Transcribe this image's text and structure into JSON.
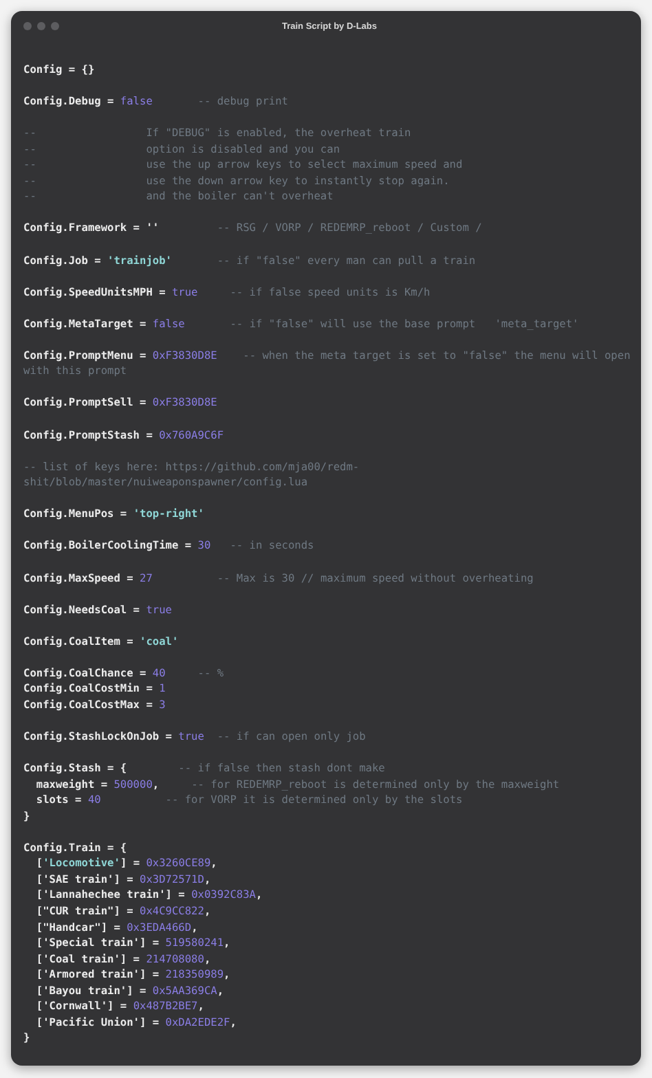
{
  "window": {
    "title": "Train Script by D-Labs"
  },
  "lines": [
    {
      "kind": "code",
      "segments": [
        {
          "kind": "code",
          "text": "Config = {}"
        }
      ]
    },
    {
      "kind": "blank"
    },
    {
      "kind": "code",
      "segments": [
        {
          "kind": "code",
          "text": "Config.Debug = "
        },
        {
          "kind": "keyword",
          "text": "false"
        },
        {
          "kind": "comment",
          "text": "       -- debug print"
        }
      ]
    },
    {
      "kind": "blank"
    },
    {
      "kind": "code",
      "segments": [
        {
          "kind": "comment",
          "text": "--                 If \"DEBUG\" is enabled, the overheat train"
        }
      ]
    },
    {
      "kind": "code",
      "segments": [
        {
          "kind": "comment",
          "text": "--                 option is disabled and you can"
        }
      ]
    },
    {
      "kind": "code",
      "segments": [
        {
          "kind": "comment",
          "text": "--                 use the up arrow keys to select maximum speed and"
        }
      ]
    },
    {
      "kind": "code",
      "segments": [
        {
          "kind": "comment",
          "text": "--                 use the down arrow key to instantly stop again."
        }
      ]
    },
    {
      "kind": "code",
      "segments": [
        {
          "kind": "comment",
          "text": "--                 and the boiler can't overheat"
        }
      ]
    },
    {
      "kind": "blank"
    },
    {
      "kind": "code",
      "segments": [
        {
          "kind": "code",
          "text": "Config.Framework = ''"
        },
        {
          "kind": "comment",
          "text": "         -- RSG / VORP / REDEMRP_reboot / Custom /"
        }
      ]
    },
    {
      "kind": "blank"
    },
    {
      "kind": "code",
      "segments": [
        {
          "kind": "code",
          "text": "Config.Job = "
        },
        {
          "kind": "string",
          "text": "'trainjob'"
        },
        {
          "kind": "comment",
          "text": "       -- if \"false\" every man can pull a train"
        }
      ]
    },
    {
      "kind": "blank"
    },
    {
      "kind": "code",
      "segments": [
        {
          "kind": "code",
          "text": "Config.SpeedUnitsMPH = "
        },
        {
          "kind": "keyword",
          "text": "true"
        },
        {
          "kind": "comment",
          "text": "     -- if false speed units is Km/h"
        }
      ]
    },
    {
      "kind": "blank"
    },
    {
      "kind": "code",
      "segments": [
        {
          "kind": "code",
          "text": "Config.MetaTarget = "
        },
        {
          "kind": "keyword",
          "text": "false"
        },
        {
          "kind": "comment",
          "text": "       -- if \"false\" will use the base prompt   'meta_target'"
        }
      ]
    },
    {
      "kind": "blank"
    },
    {
      "kind": "code",
      "segments": [
        {
          "kind": "code",
          "text": "Config.PromptMenu = "
        },
        {
          "kind": "number",
          "text": "0xF3830D8E"
        },
        {
          "kind": "comment",
          "text": "    -- when the meta target is set to \"false\" the menu will open"
        }
      ]
    },
    {
      "kind": "code",
      "segments": [
        {
          "kind": "comment",
          "text": "with this prompt"
        }
      ]
    },
    {
      "kind": "blank"
    },
    {
      "kind": "code",
      "segments": [
        {
          "kind": "code",
          "text": "Config.PromptSell = "
        },
        {
          "kind": "number",
          "text": "0xF3830D8E"
        }
      ]
    },
    {
      "kind": "blank"
    },
    {
      "kind": "code",
      "segments": [
        {
          "kind": "code",
          "text": "Config.PromptStash = "
        },
        {
          "kind": "number",
          "text": "0x760A9C6F"
        }
      ]
    },
    {
      "kind": "blank"
    },
    {
      "kind": "code",
      "segments": [
        {
          "kind": "comment",
          "text": "-- list of keys here: https://github.com/mja00/redm-"
        }
      ]
    },
    {
      "kind": "code",
      "segments": [
        {
          "kind": "comment",
          "text": "shit/blob/master/nuiweaponspawner/config.lua"
        }
      ]
    },
    {
      "kind": "blank"
    },
    {
      "kind": "code",
      "segments": [
        {
          "kind": "code",
          "text": "Config.MenuPos = "
        },
        {
          "kind": "string",
          "text": "'top-right'"
        }
      ]
    },
    {
      "kind": "blank"
    },
    {
      "kind": "code",
      "segments": [
        {
          "kind": "code",
          "text": "Config.BoilerCoolingTime = "
        },
        {
          "kind": "number",
          "text": "30"
        },
        {
          "kind": "comment",
          "text": "   -- in seconds"
        }
      ]
    },
    {
      "kind": "blank"
    },
    {
      "kind": "code",
      "segments": [
        {
          "kind": "code",
          "text": "Config.MaxSpeed = "
        },
        {
          "kind": "number",
          "text": "27"
        },
        {
          "kind": "comment",
          "text": "          -- Max is 30 // maximum speed without overheating"
        }
      ]
    },
    {
      "kind": "blank"
    },
    {
      "kind": "code",
      "segments": [
        {
          "kind": "code",
          "text": "Config.NeedsCoal = "
        },
        {
          "kind": "keyword",
          "text": "true"
        }
      ]
    },
    {
      "kind": "blank"
    },
    {
      "kind": "code",
      "segments": [
        {
          "kind": "code",
          "text": "Config.CoalItem = "
        },
        {
          "kind": "string",
          "text": "'coal'"
        }
      ]
    },
    {
      "kind": "blank"
    },
    {
      "kind": "code",
      "segments": [
        {
          "kind": "code",
          "text": "Config.CoalChance = "
        },
        {
          "kind": "number",
          "text": "40"
        },
        {
          "kind": "comment",
          "text": "     -- %"
        }
      ]
    },
    {
      "kind": "code",
      "segments": [
        {
          "kind": "code",
          "text": "Config.CoalCostMin = "
        },
        {
          "kind": "number",
          "text": "1"
        }
      ]
    },
    {
      "kind": "code",
      "segments": [
        {
          "kind": "code",
          "text": "Config.CoalCostMax = "
        },
        {
          "kind": "number",
          "text": "3"
        }
      ]
    },
    {
      "kind": "blank"
    },
    {
      "kind": "code",
      "segments": [
        {
          "kind": "code",
          "text": "Config.StashLockOnJob = "
        },
        {
          "kind": "keyword",
          "text": "true"
        },
        {
          "kind": "comment",
          "text": "  -- if can open only job"
        }
      ]
    },
    {
      "kind": "blank"
    },
    {
      "kind": "code",
      "segments": [
        {
          "kind": "code",
          "text": "Config.Stash = {"
        },
        {
          "kind": "comment",
          "text": "        -- if false then stash dont make"
        }
      ]
    },
    {
      "kind": "code",
      "segments": [
        {
          "kind": "code",
          "text": "  maxweight = "
        },
        {
          "kind": "number",
          "text": "500000"
        },
        {
          "kind": "code",
          "text": ","
        },
        {
          "kind": "comment",
          "text": "     -- for REDEMRP_reboot is determined only by the maxweight"
        }
      ]
    },
    {
      "kind": "code",
      "segments": [
        {
          "kind": "code",
          "text": "  slots = "
        },
        {
          "kind": "number",
          "text": "40"
        },
        {
          "kind": "comment",
          "text": "          -- for VORP it is determined only by the slots"
        }
      ]
    },
    {
      "kind": "code",
      "segments": [
        {
          "kind": "code",
          "text": "}"
        }
      ]
    },
    {
      "kind": "blank"
    },
    {
      "kind": "code",
      "segments": [
        {
          "kind": "code",
          "text": "Config.Train = {"
        }
      ]
    },
    {
      "kind": "code",
      "segments": [
        {
          "kind": "code",
          "text": "  ["
        },
        {
          "kind": "string",
          "text": "'Locomotive'"
        },
        {
          "kind": "code",
          "text": "] = "
        },
        {
          "kind": "number",
          "text": "0x3260CE89"
        },
        {
          "kind": "code",
          "text": ","
        }
      ]
    },
    {
      "kind": "code",
      "segments": [
        {
          "kind": "code",
          "text": "  ['SAE train'] = "
        },
        {
          "kind": "number",
          "text": "0x3D72571D"
        },
        {
          "kind": "code",
          "text": ","
        }
      ]
    },
    {
      "kind": "code",
      "segments": [
        {
          "kind": "code",
          "text": "  ['Lannahechee train'] = "
        },
        {
          "kind": "number",
          "text": "0x0392C83A"
        },
        {
          "kind": "code",
          "text": ","
        }
      ]
    },
    {
      "kind": "code",
      "segments": [
        {
          "kind": "code",
          "text": "  [\"CUR train\"] = "
        },
        {
          "kind": "number",
          "text": "0x4C9CC822"
        },
        {
          "kind": "code",
          "text": ","
        }
      ]
    },
    {
      "kind": "code",
      "segments": [
        {
          "kind": "code",
          "text": "  [\"Handcar\"] = "
        },
        {
          "kind": "number",
          "text": "0x3EDA466D"
        },
        {
          "kind": "code",
          "text": ","
        }
      ]
    },
    {
      "kind": "code",
      "segments": [
        {
          "kind": "code",
          "text": "  ['Special train'] = "
        },
        {
          "kind": "number",
          "text": "519580241"
        },
        {
          "kind": "code",
          "text": ","
        }
      ]
    },
    {
      "kind": "code",
      "segments": [
        {
          "kind": "code",
          "text": "  ['Coal train'] = "
        },
        {
          "kind": "number",
          "text": "214708080"
        },
        {
          "kind": "code",
          "text": ","
        }
      ]
    },
    {
      "kind": "code",
      "segments": [
        {
          "kind": "code",
          "text": "  ['Armored train'] = "
        },
        {
          "kind": "number",
          "text": "218350989"
        },
        {
          "kind": "code",
          "text": ","
        }
      ]
    },
    {
      "kind": "code",
      "segments": [
        {
          "kind": "code",
          "text": "  ['Bayou train'] = "
        },
        {
          "kind": "number",
          "text": "0x5AA369CA"
        },
        {
          "kind": "code",
          "text": ","
        }
      ]
    },
    {
      "kind": "code",
      "segments": [
        {
          "kind": "code",
          "text": "  ['Cornwall'] = "
        },
        {
          "kind": "number",
          "text": "0x487B2BE7"
        },
        {
          "kind": "code",
          "text": ","
        }
      ]
    },
    {
      "kind": "code",
      "segments": [
        {
          "kind": "code",
          "text": "  ['Pacific Union'] = "
        },
        {
          "kind": "number",
          "text": "0xDA2EDE2F"
        },
        {
          "kind": "code",
          "text": ","
        }
      ]
    },
    {
      "kind": "code",
      "segments": [
        {
          "kind": "code",
          "text": "}"
        }
      ]
    }
  ]
}
